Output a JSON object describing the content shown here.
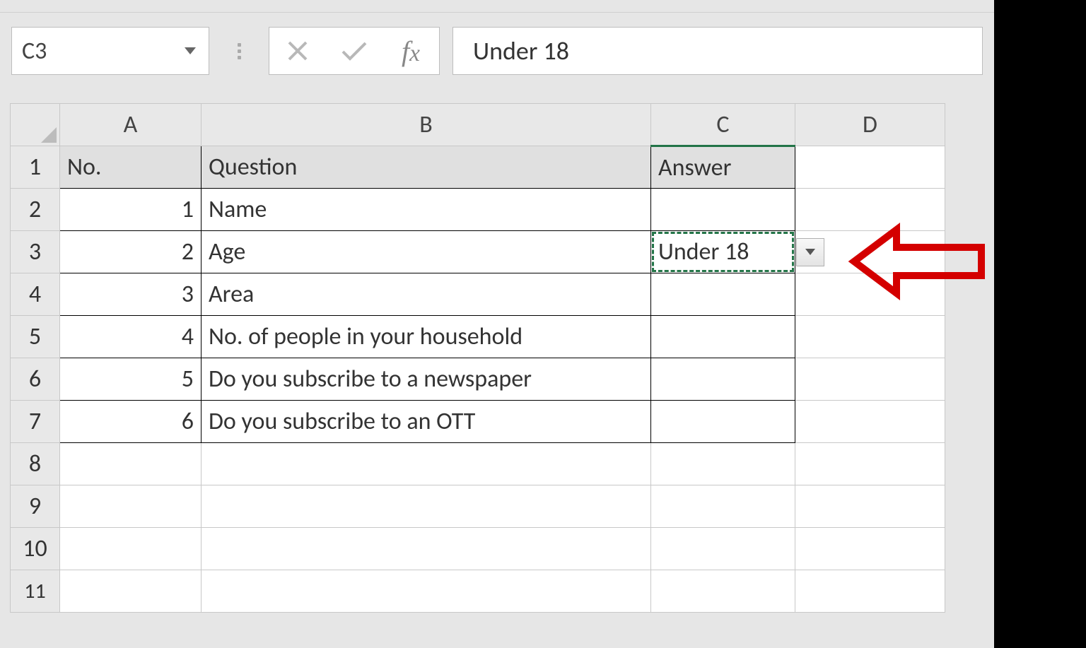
{
  "nameBox": {
    "ref": "C3"
  },
  "formulaBar": {
    "value": "Under 18"
  },
  "columns": [
    "A",
    "B",
    "C",
    "D"
  ],
  "rowNumbers": [
    "1",
    "2",
    "3",
    "4",
    "5",
    "6",
    "7",
    "8",
    "9",
    "10",
    "11"
  ],
  "headers": {
    "A": "No.",
    "B": "Question",
    "C": "Answer"
  },
  "rows": [
    {
      "no": "1",
      "question": "Name",
      "answer": ""
    },
    {
      "no": "2",
      "question": "Age",
      "answer": "Under 18"
    },
    {
      "no": "3",
      "question": "Area",
      "answer": ""
    },
    {
      "no": "4",
      "question": "No. of people in your household",
      "answer": ""
    },
    {
      "no": "5",
      "question": "Do you subscribe to a newspaper",
      "answer": ""
    },
    {
      "no": "6",
      "question": "Do you subscribe to an OTT",
      "answer": ""
    }
  ],
  "selectedCell": "C3"
}
